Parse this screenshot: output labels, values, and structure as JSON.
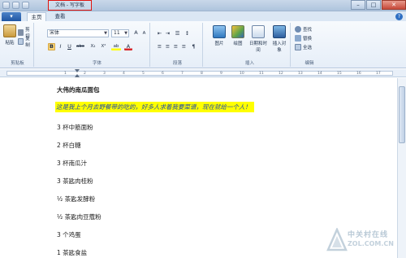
{
  "window": {
    "title": "文档 - 写字板",
    "controls": {
      "minimize": "–",
      "maximize": "□",
      "close": "✕"
    }
  },
  "ribbon_tabs": [
    {
      "label": "主页",
      "active": true
    },
    {
      "label": "查看",
      "active": false
    }
  ],
  "clipboard": {
    "paste_label": "粘贴",
    "cut_label": "剪切",
    "copy_label": "复制",
    "group_label": "剪贴板"
  },
  "font": {
    "family_value": "宋体",
    "size_value": "11",
    "grow_label": "A",
    "shrink_label": "A",
    "bold": "B",
    "italic": "I",
    "underline": "U",
    "strike": "abc",
    "subscript": "X₂",
    "superscript": "X²",
    "highlight": "ab",
    "color": "A",
    "group_label": "字体"
  },
  "paragraph": {
    "group_label": "段落"
  },
  "insert": {
    "picture_label": "图片",
    "paint_label": "绘图",
    "datetime_label": "日期和时间",
    "object_label": "插入对象",
    "group_label": "插入"
  },
  "editing": {
    "find_label": "查找",
    "replace_label": "替换",
    "select_all_label": "全选",
    "group_label": "编辑"
  },
  "ruler_ticks": [
    "1",
    "2",
    "3",
    "4",
    "5",
    "6",
    "7",
    "8",
    "9",
    "10",
    "11",
    "12",
    "13",
    "14",
    "15",
    "16",
    "17"
  ],
  "document": {
    "title": "大伟的南瓜面包",
    "intro": "这是我上个月去野餐带的吃的，好多人求着我要菜谱，现在就给一个人！",
    "ingredients": [
      "3  杯中筋面粉",
      "2  杯白糖",
      "3  杯南瓜汁",
      "3  茶匙肉桂粉",
      "½  茶匙发酵粉",
      "½  茶匙肉豆蔻粉",
      "3  个鸡蛋",
      "1  茶匙食盐"
    ]
  },
  "watermark": {
    "cn": "中关村在线",
    "en": "ZOL.COM.CN"
  },
  "colors": {
    "highlight": "#ffff00",
    "intro_text": "#1f4aa8",
    "title_border": "#e0140e"
  }
}
